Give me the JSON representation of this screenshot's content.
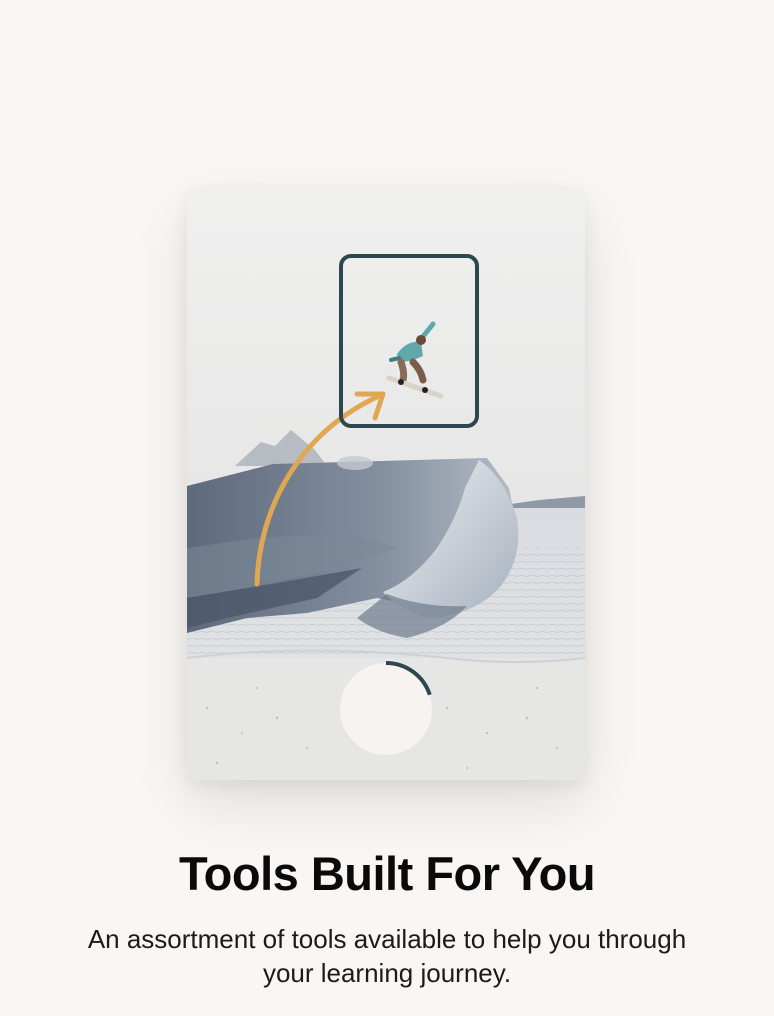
{
  "onboarding": {
    "title": "Tools Built For You",
    "description": "An assortment of tools available to help you through your learning journey."
  },
  "illustration": {
    "photo_subject": "snowboarder-jump",
    "frame_color": "#2c474e",
    "arrow_color": "#e0a752",
    "progress_ring_color": "#2c474e",
    "progress_fraction": 0.2
  },
  "colors": {
    "background": "#f9f6f3",
    "title_text": "#0a0a0a",
    "body_text": "#1b1b1b"
  }
}
